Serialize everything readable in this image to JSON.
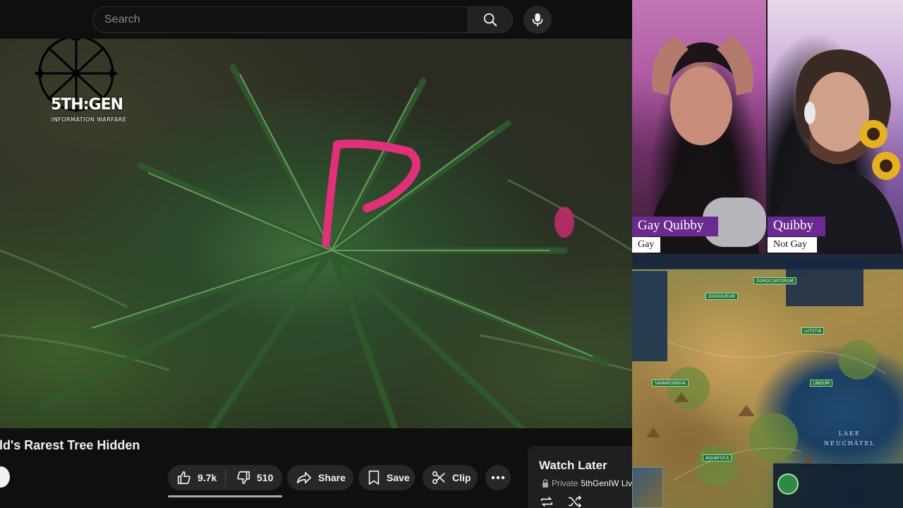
{
  "search": {
    "placeholder": "Search"
  },
  "video": {
    "title": "rld's Rarest Tree Hidden",
    "watermark": {
      "title": "5TH:GEN",
      "subtitle": "INFORMATION WARFARE"
    }
  },
  "actions": {
    "likes": "9.7k",
    "dislikes": "510",
    "share": "Share",
    "save": "Save",
    "clip": "Clip"
  },
  "playlist": {
    "title": "Watch Later",
    "privacy": "Private",
    "channel": "5thGenIW Liv"
  },
  "webcams": [
    {
      "name": "Gay Quibby",
      "label": "Gay"
    },
    {
      "name": "Quibby",
      "label": "Not Gay"
    }
  ],
  "game": {
    "lake_label_line1": "LAKE",
    "lake_label_line2": "NEUCHÂTEL",
    "cities": [
      "DIVODURUM",
      "DUROCORTORUM",
      "LUTETIA",
      "SAMAROBRIVA",
      "LINDUM",
      "AQUAFUCA"
    ]
  },
  "colors": {
    "name_tag_bg": "#6a2a8f",
    "page_bg": "#0f0f0f",
    "pill_bg": "#272727"
  },
  "icons": [
    "search-icon",
    "mic-icon",
    "thumbs-up-icon",
    "thumbs-down-icon",
    "share-icon",
    "bookmark-icon",
    "scissors-icon",
    "more-icon",
    "lock-icon",
    "loop-icon",
    "shuffle-icon"
  ]
}
